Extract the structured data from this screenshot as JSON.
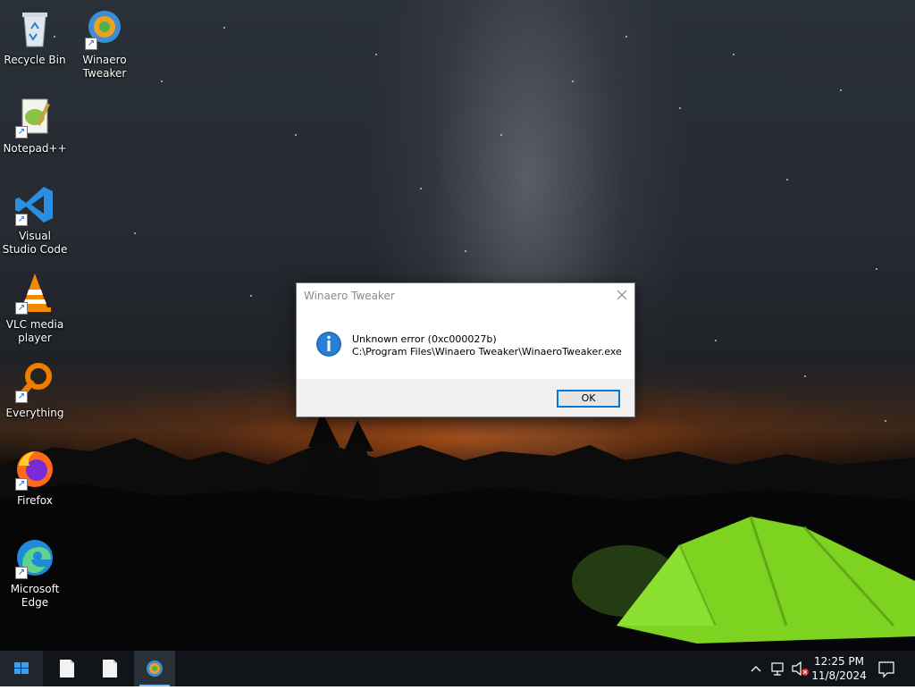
{
  "desktop": {
    "icons": [
      {
        "label": "Recycle Bin",
        "icon": "recycle-bin-icon"
      },
      {
        "label": "Winaero Tweaker",
        "icon": "winaero-tweaker-icon"
      },
      {
        "label": "Notepad++",
        "icon": "notepad-plus-plus-icon"
      },
      {
        "label": "Visual Studio Code",
        "icon": "vscode-icon"
      },
      {
        "label": "VLC media player",
        "icon": "vlc-icon"
      },
      {
        "label": "Everything",
        "icon": "everything-search-icon"
      },
      {
        "label": "Firefox",
        "icon": "firefox-icon"
      },
      {
        "label": "Microsoft Edge",
        "icon": "edge-icon"
      }
    ]
  },
  "dialog": {
    "title": "Winaero Tweaker",
    "message_line1": "Unknown error (0xc000027b)",
    "message_line2": "C:\\Program Files\\Winaero Tweaker\\WinaeroTweaker.exe",
    "ok_label": "OK",
    "icon": "info-icon"
  },
  "taskbar": {
    "start_icon": "windows-logo-icon",
    "apps": [
      {
        "icon": "document-icon"
      },
      {
        "icon": "document-icon"
      },
      {
        "icon": "winaero-tweaker-icon",
        "active": true
      }
    ],
    "tray_icons": [
      "chevron-up-icon",
      "network-icon",
      "volume-muted-icon"
    ],
    "clock": {
      "time": "12:25 PM",
      "date": "11/8/2024"
    },
    "notifications_icon": "action-center-icon"
  },
  "colors": {
    "accent": "#0078d7",
    "taskbar": "#111418",
    "tent_green": "#7ed321"
  }
}
